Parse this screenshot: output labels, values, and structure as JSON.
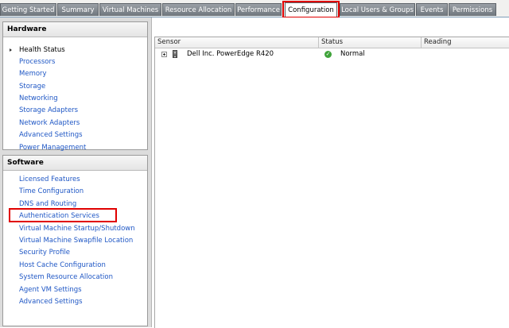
{
  "tabs": [
    {
      "label": "Getting Started"
    },
    {
      "label": "Summary"
    },
    {
      "label": "Virtual Machines"
    },
    {
      "label": "Resource Allocation"
    },
    {
      "label": "Performance"
    },
    {
      "label": "Configuration",
      "active": true
    },
    {
      "label": "Local Users & Groups"
    },
    {
      "label": "Events"
    },
    {
      "label": "Permissions"
    }
  ],
  "sidebar": {
    "hardware": {
      "title": "Hardware",
      "items": [
        {
          "label": "Health Status",
          "selected": true
        },
        {
          "label": "Processors"
        },
        {
          "label": "Memory"
        },
        {
          "label": "Storage"
        },
        {
          "label": "Networking"
        },
        {
          "label": "Storage Adapters"
        },
        {
          "label": "Network Adapters"
        },
        {
          "label": "Advanced Settings"
        },
        {
          "label": "Power Management"
        }
      ]
    },
    "software": {
      "title": "Software",
      "items": [
        {
          "label": "Licensed Features"
        },
        {
          "label": "Time Configuration"
        },
        {
          "label": "DNS and Routing"
        },
        {
          "label": "Authentication Services",
          "highlighted": true
        },
        {
          "label": "Virtual Machine Startup/Shutdown"
        },
        {
          "label": "Virtual Machine Swapfile Location"
        },
        {
          "label": "Security Profile"
        },
        {
          "label": "Host Cache Configuration"
        },
        {
          "label": "System Resource Allocation"
        },
        {
          "label": "Agent VM Settings"
        },
        {
          "label": "Advanced Settings"
        }
      ]
    }
  },
  "sensor_table": {
    "columns": {
      "sensor": "Sensor",
      "status": "Status",
      "reading": "Reading"
    },
    "rows": [
      {
        "sensor": "Dell Inc. PowerEdge R420",
        "status": "Normal",
        "status_icon": "check-circle-icon",
        "reading": ""
      }
    ]
  },
  "colors": {
    "link": "#1f57c5",
    "highlight": "#e00000",
    "status_ok": "#3fa33a",
    "tab_inactive": "#7c838a"
  }
}
